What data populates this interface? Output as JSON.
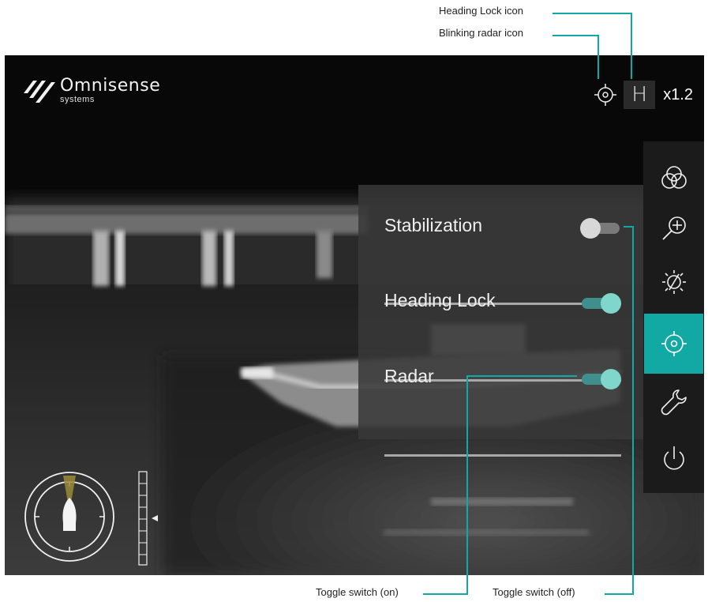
{
  "annotations": {
    "heading_lock_icon": "Heading Lock icon",
    "blinking_radar_icon": "Blinking radar icon",
    "toggle_on": "Toggle switch (on)",
    "toggle_off": "Toggle switch (off)"
  },
  "brand": {
    "name": "Omnisense",
    "sub": "systems"
  },
  "status": {
    "heading_letter": "H",
    "zoom": "x1.2"
  },
  "settings": [
    {
      "label": "Stabilization",
      "state": "off"
    },
    {
      "label": "Heading Lock",
      "state": "on"
    },
    {
      "label": "Radar",
      "state": "on"
    }
  ],
  "sidebar": {
    "items": [
      {
        "icon": "color-palette-icon",
        "active": false
      },
      {
        "icon": "zoom-in-icon",
        "active": false
      },
      {
        "icon": "brightness-off-icon",
        "active": false
      },
      {
        "icon": "target-crosshair-icon",
        "active": true
      },
      {
        "icon": "wrench-icon",
        "active": false
      },
      {
        "icon": "power-icon",
        "active": false
      }
    ]
  },
  "colors": {
    "accent": "#12a8a3",
    "toggle_on_track": "#3f8f8c",
    "toggle_on_knob": "#7fd6cc",
    "toggle_off_track": "#7a7a7a",
    "toggle_off_knob": "#d8d8d8",
    "callout_line": "#12a8a3"
  }
}
